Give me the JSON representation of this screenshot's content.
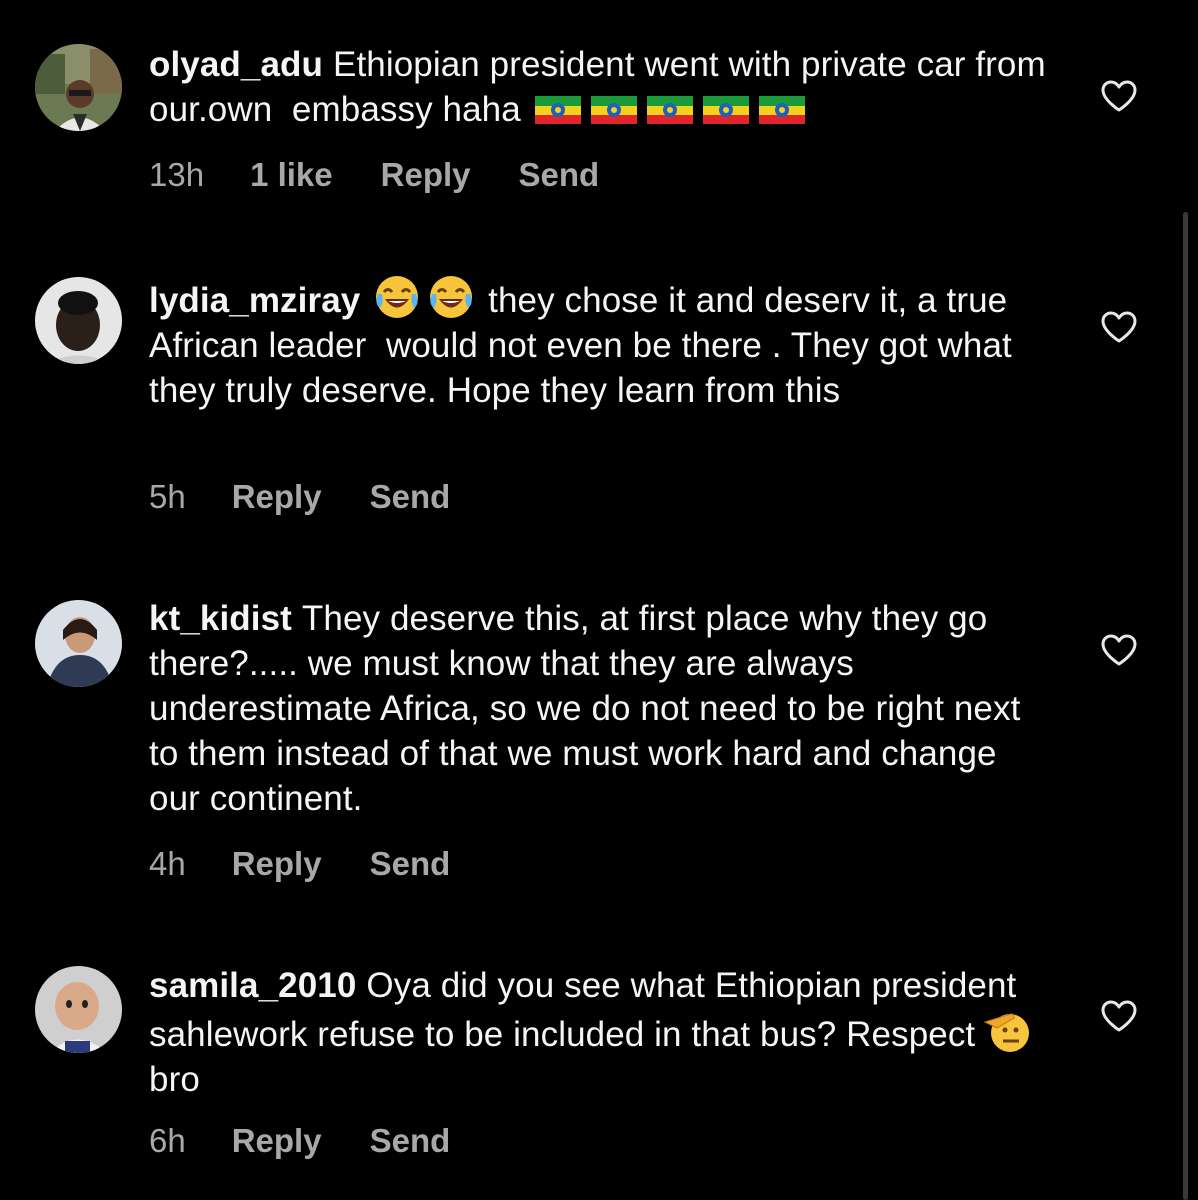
{
  "comments": [
    {
      "username": "olyad_adu",
      "text": "Ethiopian president went with private car from our.own  embassy haha",
      "emojis": [
        "ethiopia-flag",
        "ethiopia-flag",
        "ethiopia-flag",
        "ethiopia-flag",
        "ethiopia-flag"
      ],
      "time": "13h",
      "likes": "1 like",
      "reply_label": "Reply",
      "send_label": "Send"
    },
    {
      "username": "lydia_mziray",
      "emojis": [
        "face-with-tears-of-joy",
        "face-with-tears-of-joy"
      ],
      "text": "they chose it and deserv it, a true African leader  would not even be there . They got what they truly deserve. Hope they learn from this",
      "time": "5h",
      "reply_label": "Reply",
      "send_label": "Send"
    },
    {
      "username": "kt_kidist",
      "text": "They deserve this, at first place why they go there?..... we must know that they are always underestimate Africa, so we do not need to be right next to them instead of that we must work hard and change our continent.",
      "time": "4h",
      "reply_label": "Reply",
      "send_label": "Send"
    },
    {
      "username": "samila_2010",
      "text_before": "Oya did you see what Ethiopian president sahlework refuse to be included in that bus? Respect",
      "emojis": [
        "saluting-face"
      ],
      "text_after": "bro",
      "time": "6h",
      "reply_label": "Reply",
      "send_label": "Send"
    }
  ],
  "colors": {
    "background": "#000000",
    "text": "#f5f5f5",
    "meta": "#a8a8a8"
  },
  "icons": {
    "like": "heart-outline-icon"
  }
}
